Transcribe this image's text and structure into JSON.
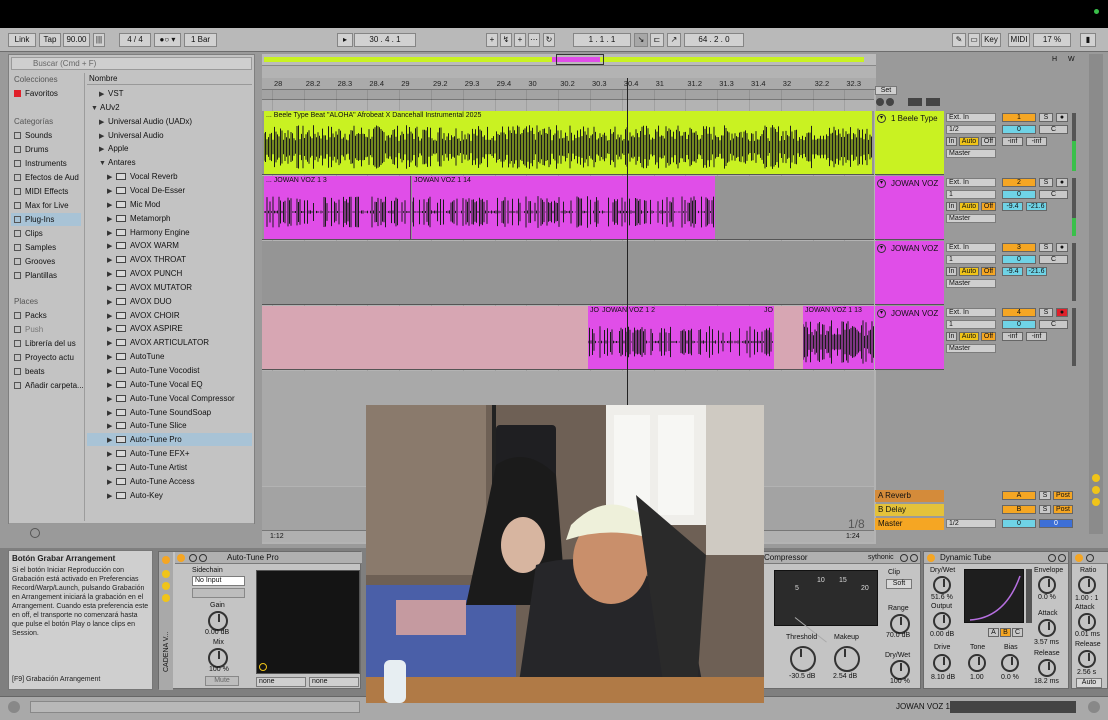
{
  "transport": {
    "link": "Link",
    "tap": "Tap",
    "tempo": "90.00",
    "time_sig": "4 / 4",
    "quantize": "1 Bar",
    "position": "30 . 4 . 1",
    "loop_start": "1 . 1 . 1",
    "loop_length": "64 . 2 . 0",
    "key": "Key",
    "midi": "MIDI",
    "cpu": "17 %"
  },
  "browser": {
    "search_placeholder": "Buscar (Cmd + F)",
    "collections_header": "Colecciones",
    "favorites": "Favoritos",
    "categories_header": "Categorías",
    "categories": [
      "Sounds",
      "Drums",
      "Instruments",
      "Efectos de Aud",
      "MIDI Effects",
      "Max for Live",
      "Plug-Ins",
      "Clips",
      "Samples",
      "Grooves",
      "Plantillas"
    ],
    "places_header": "Places",
    "places": [
      "Packs",
      "Push",
      "Librería del us",
      "Proyecto actu",
      "beats",
      "Añadir carpeta..."
    ],
    "name_header": "Nombre",
    "tree": [
      {
        "label": "VST",
        "indent": 1,
        "expanded": false,
        "plugin": false
      },
      {
        "label": "AUv2",
        "indent": 0,
        "expanded": true,
        "plugin": false
      },
      {
        "label": "Universal Audio (UADx)",
        "indent": 1,
        "expanded": false,
        "plugin": false
      },
      {
        "label": "Universal Audio",
        "indent": 1,
        "expanded": false,
        "plugin": false
      },
      {
        "label": "Apple",
        "indent": 1,
        "expanded": false,
        "plugin": false
      },
      {
        "label": "Antares",
        "indent": 1,
        "expanded": true,
        "plugin": false
      },
      {
        "label": "Vocal Reverb",
        "indent": 2,
        "plugin": true
      },
      {
        "label": "Vocal De-Esser",
        "indent": 2,
        "plugin": true
      },
      {
        "label": "Mic Mod",
        "indent": 2,
        "plugin": true
      },
      {
        "label": "Metamorph",
        "indent": 2,
        "plugin": true
      },
      {
        "label": "Harmony Engine",
        "indent": 2,
        "plugin": true
      },
      {
        "label": "AVOX WARM",
        "indent": 2,
        "plugin": true
      },
      {
        "label": "AVOX THROAT",
        "indent": 2,
        "plugin": true
      },
      {
        "label": "AVOX PUNCH",
        "indent": 2,
        "plugin": true
      },
      {
        "label": "AVOX MUTATOR",
        "indent": 2,
        "plugin": true
      },
      {
        "label": "AVOX DUO",
        "indent": 2,
        "plugin": true
      },
      {
        "label": "AVOX CHOIR",
        "indent": 2,
        "plugin": true
      },
      {
        "label": "AVOX ASPIRE",
        "indent": 2,
        "plugin": true
      },
      {
        "label": "AVOX ARTICULATOR",
        "indent": 2,
        "plugin": true
      },
      {
        "label": "AutoTune",
        "indent": 2,
        "plugin": true
      },
      {
        "label": "Auto-Tune Vocodist",
        "indent": 2,
        "plugin": true
      },
      {
        "label": "Auto-Tune Vocal EQ",
        "indent": 2,
        "plugin": true
      },
      {
        "label": "Auto-Tune Vocal Compressor",
        "indent": 2,
        "plugin": true
      },
      {
        "label": "Auto-Tune SoundSoap",
        "indent": 2,
        "plugin": true
      },
      {
        "label": "Auto-Tune Slice",
        "indent": 2,
        "plugin": true
      },
      {
        "label": "Auto-Tune Pro",
        "indent": 2,
        "plugin": true,
        "selected": true
      },
      {
        "label": "Auto-Tune EFX+",
        "indent": 2,
        "plugin": true
      },
      {
        "label": "Auto-Tune Artist",
        "indent": 2,
        "plugin": true
      },
      {
        "label": "Auto-Tune Access",
        "indent": 2,
        "plugin": true
      },
      {
        "label": "Auto-Key",
        "indent": 2,
        "plugin": true
      }
    ]
  },
  "ruler": [
    "28",
    "28.2",
    "28.3",
    "28.4",
    "29",
    "29.2",
    "29.3",
    "29.4",
    "30",
    "30.2",
    "30.3",
    "30.4",
    "31",
    "31.2",
    "31.3",
    "31.4",
    "32",
    "32.2",
    "32.3"
  ],
  "bottom_ruler": {
    "left": "1:12",
    "right": "1:24",
    "page": "1/8"
  },
  "set_label": "Set",
  "clips": {
    "beat": "... Beele Type Beat \"ALOHA\" Afrobeat X Dancehall Instrumental 2025",
    "voz13": "... JOWAN VOZ 1 3",
    "voz14": "JOWAN VOZ 1 14",
    "voz12a": "JO",
    "voz12b": "JOWAN VOZ 1 2",
    "voz12c": "JO",
    "voz113": "JOWAN VOZ 1 13"
  },
  "tracks": [
    {
      "num": "1",
      "name": "1 Beele Type",
      "input": "Ext. In",
      "channel": "1/2",
      "vol": "0",
      "pan": "C",
      "peak1": "-inf",
      "peak2": "-inf"
    },
    {
      "num": "2",
      "name": "JOWAN VOZ",
      "input": "Ext. In",
      "channel": "1",
      "vol": "0",
      "pan": "C",
      "peak1": "-9.4",
      "peak2": "-21.6"
    },
    {
      "num": "3",
      "name": "JOWAN VOZ",
      "input": "Ext. In",
      "channel": "1",
      "vol": "0",
      "pan": "C",
      "peak1": "-9.4",
      "peak2": "-21.6"
    },
    {
      "num": "4",
      "name": "JOWAN VOZ",
      "input": "Ext. In",
      "channel": "1",
      "vol": "0",
      "pan": "C",
      "peak1": "-inf",
      "peak2": "-inf"
    }
  ],
  "io_labels": {
    "in": "In",
    "auto": "Auto",
    "off": "Off",
    "master": "Master",
    "s": "S"
  },
  "returns": [
    {
      "letter": "A",
      "name": "A Reverb",
      "post": "Post"
    },
    {
      "letter": "B",
      "name": "B Delay",
      "post": "Post"
    }
  ],
  "master": {
    "name": "Master",
    "channel": "1/2",
    "vol": "0",
    "pan": "0"
  },
  "info": {
    "title": "Botón Grabar Arrangement",
    "body": "Si el botón Iniciar Reproducción con Grabación está activado en Preferencias Record/Warp/Launch, pulsando Grabación en Arrangement iniciará la grabación en el Arrangement. Cuando esta preferencia este en off, el transporte no comenzará hasta que pulse el botón Play o lance clips en Session.",
    "shortcut": "[F9] Grabación Arrangement"
  },
  "autotune": {
    "title": "Auto-Tune Pro",
    "chain": "CADENA V...",
    "sidechain": "Sidechain",
    "sidechain_value": "No Input",
    "gain": "Gain",
    "gain_value": "0.00 dB",
    "mix": "Mix",
    "mix_value": "100 %",
    "mute": "Mute",
    "none1": "none",
    "none2": "none"
  },
  "compressor": {
    "title": "Compressor",
    "brand": "sythonic",
    "scale": [
      "5",
      "10",
      "15",
      "20"
    ],
    "clip": "Clip",
    "soft": "Soft",
    "range": "Range",
    "range_value": "70.0 dB",
    "threshold": "Threshold",
    "threshold_value": "-30.5 dB",
    "makeup": "Makeup",
    "makeup_value": "2.54 dB",
    "drywet": "Dry/Wet",
    "drywet_value": "100 %"
  },
  "dynamic_tube": {
    "title": "Dynamic Tube",
    "drywet": "Dry/Wet",
    "drywet_value": "51.6 %",
    "output": "Output",
    "output_value": "0.00 dB",
    "drive": "Drive",
    "drive_value": "8.10 dB",
    "tone": "Tone",
    "tone_value": "1.00",
    "bias": "Bias",
    "bias_value": "0.0 %",
    "envelope": "Envelope",
    "envelope_value": "0.0 %",
    "attack": "Attack",
    "attack_value": "3.57 ms",
    "release": "Release",
    "release_value": "18.2 ms",
    "abc": [
      "A",
      "B",
      "C"
    ]
  },
  "compressor2": {
    "ratio": "Ratio",
    "ratio_value": "1.00 : 1",
    "attack": "Attack",
    "attack_value": "0.01 ms",
    "release": "Release",
    "release_value": "2.56 s",
    "auto": "Auto"
  },
  "status": {
    "track": "JOWAN VOZ 1"
  },
  "colors": {
    "beat": "#c9f222",
    "voz": "#e04ee8",
    "voz_pale": "#d7a6b3",
    "record": "#e0202a",
    "play": "#2fb84a"
  }
}
